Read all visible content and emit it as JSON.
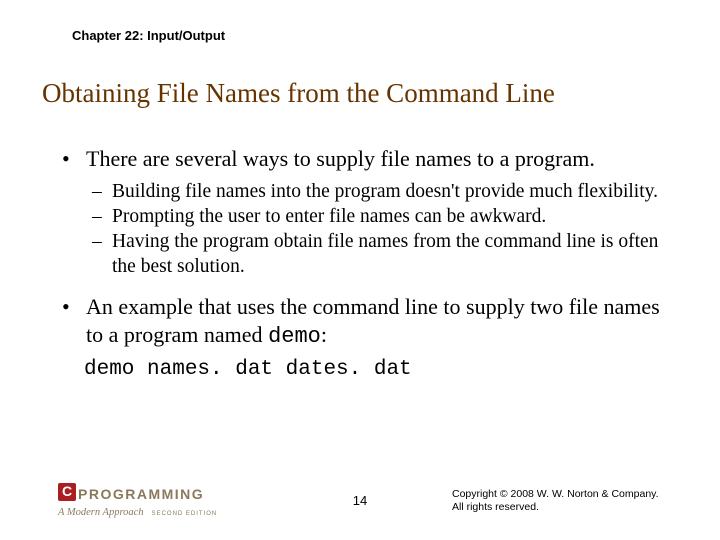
{
  "chapter": "Chapter 22: Input/Output",
  "title": "Obtaining File Names from the Command Line",
  "bullets": {
    "b1": "There are several ways to supply file names to a program.",
    "sub1": "Building file names into the program doesn't provide much flexibility.",
    "sub2": "Prompting the user to enter file names can be awkward.",
    "sub3": "Having the program obtain file names from the command line is often the best solution.",
    "b2_pre": "An example that uses the command line to supply two file names to a program named ",
    "b2_code": "demo",
    "b2_post": ":",
    "cmd": "demo names. dat dates. dat"
  },
  "footer": {
    "logo_main": "PROGRAMMING",
    "logo_sub": "A Modern Approach",
    "logo_ed": "SECOND EDITION",
    "page": "14",
    "copy1": "Copyright © 2008 W. W. Norton & Company.",
    "copy2": "All rights reserved."
  }
}
